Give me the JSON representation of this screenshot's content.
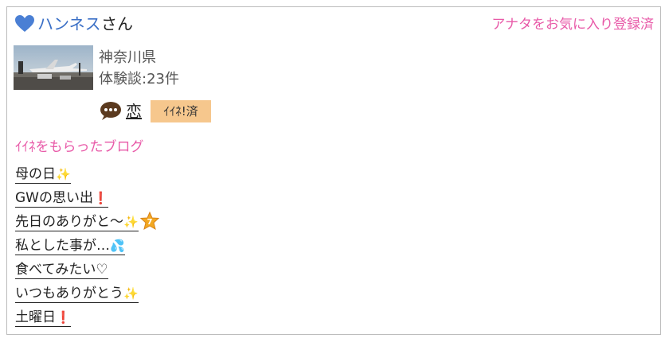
{
  "user": {
    "name": "ハンネス",
    "suffix": "さん"
  },
  "favorite_status": "アナタをお気に入り登録済",
  "profile": {
    "prefecture": "神奈川県",
    "experience_count": "体験談:23件"
  },
  "category": {
    "label": "恋",
    "iine_badge": "ｲｲﾈ!済"
  },
  "section_title": "ｲｲﾈをもらったブログ",
  "blogs": [
    {
      "title": "母の日",
      "emoji": "sparkles"
    },
    {
      "title": "GWの思い出",
      "emoji": "heavy-exclamation"
    },
    {
      "title": "先日のありがと〜",
      "emoji": "sparkles"
    },
    {
      "title": "私とした事が…",
      "emoji": "sweat-droplets"
    },
    {
      "title": "食べてみたい♡",
      "emoji": ""
    },
    {
      "title": "いつもありがとう",
      "emoji": "sparkles"
    },
    {
      "title": "土曜日",
      "emoji": "heavy-exclamation"
    }
  ],
  "badge_number": "7",
  "colors": {
    "accent_pink": "#e85aa8",
    "link_blue": "#3a6fc6",
    "iine_badge_bg": "#f6c78d",
    "heart_blue": "#4a7fd4",
    "bubble_brown": "#5b3a1f"
  }
}
